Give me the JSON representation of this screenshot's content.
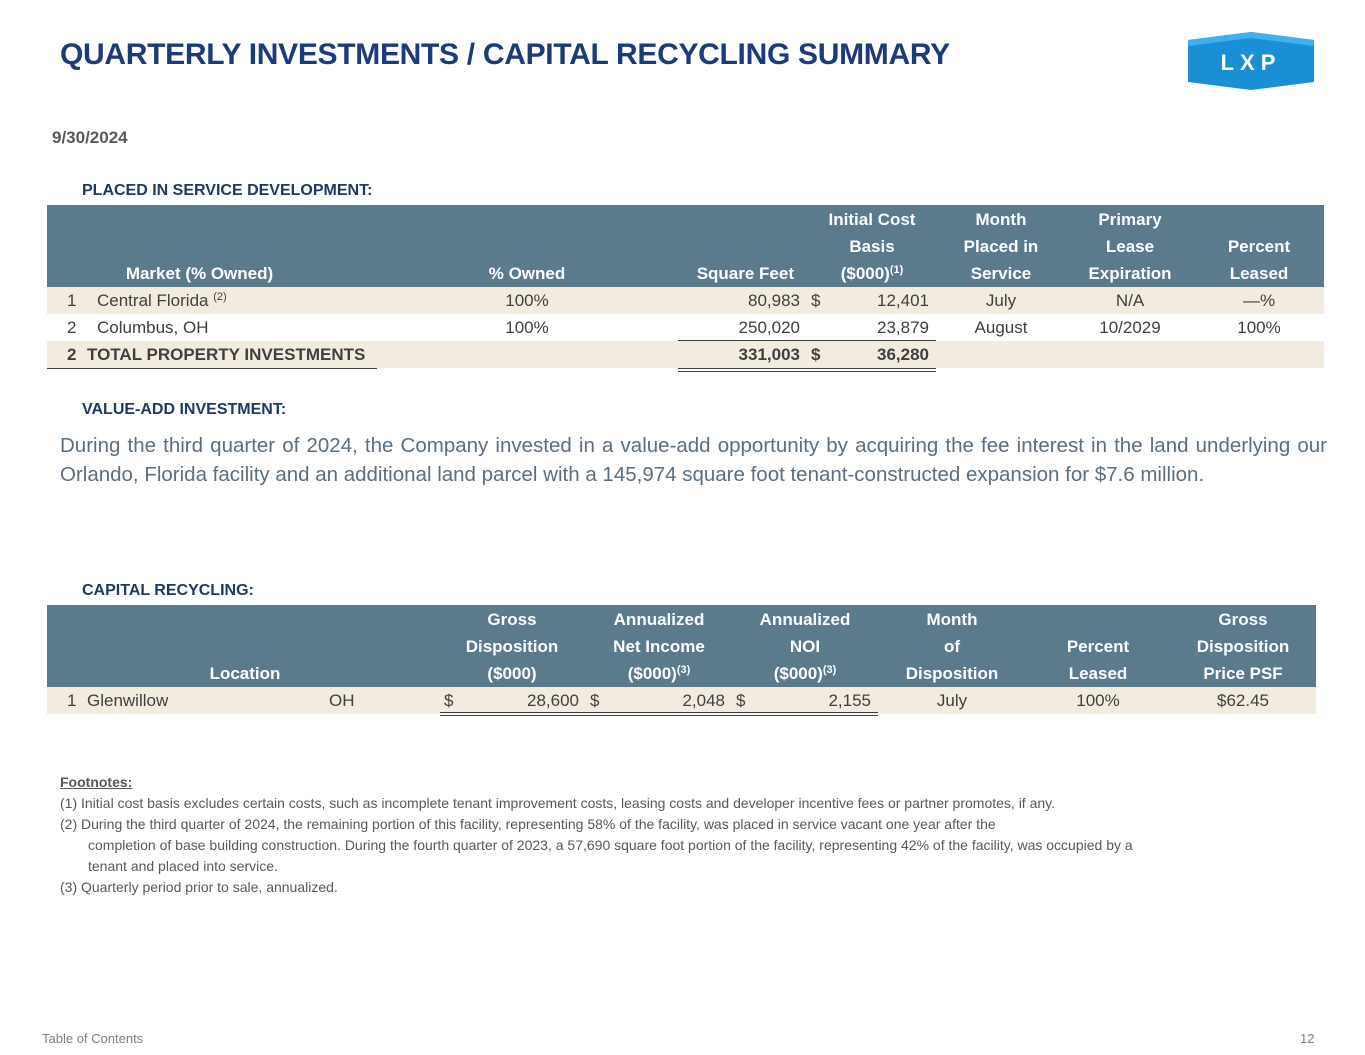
{
  "header": {
    "title": "QUARTERLY INVESTMENTS / CAPITAL RECYCLING SUMMARY",
    "logo_text": "LXP",
    "date": "9/30/2024"
  },
  "placed": {
    "label": "PLACED IN SERVICE DEVELOPMENT:",
    "headers": {
      "market": "Market (% Owned)",
      "owned": "% Owned",
      "sqft": "Square Feet",
      "cost_1": "Initial Cost",
      "cost_2": "Basis",
      "cost_3": "($000)",
      "cost_sup": "(1)",
      "month_1": "Month",
      "month_2": "Placed in",
      "month_3": "Service",
      "lease_1": "Primary",
      "lease_2": "Lease",
      "lease_3": "Expiration",
      "pct_1": "Percent",
      "pct_2": "Leased"
    },
    "rows": [
      {
        "num": "1",
        "market": "Central Florida",
        "sup": "(2)",
        "owned": "100%",
        "sqft": "80,983",
        "dollar": "$",
        "cost": "12,401",
        "month": "July",
        "lease": "N/A",
        "pct": "—%"
      },
      {
        "num": "2",
        "market": "Columbus, OH",
        "sup": "",
        "owned": "100%",
        "sqft": "250,020",
        "dollar": "",
        "cost": "23,879",
        "month": "August",
        "lease": "10/2029",
        "pct": "100%"
      }
    ],
    "total": {
      "num": "2",
      "label": "TOTAL PROPERTY INVESTMENTS",
      "sqft": "331,003",
      "dollar": "$",
      "cost": "36,280"
    }
  },
  "value_add": {
    "label": "VALUE-ADD INVESTMENT:",
    "text": "During the third quarter of 2024, the Company invested in a value-add opportunity by acquiring the fee interest in the land underlying our Orlando, Florida facility and an additional land parcel with a 145,974 square foot tenant-constructed expansion for $7.6 million."
  },
  "recycling": {
    "label": "CAPITAL RECYCLING:",
    "headers": {
      "location": "Location",
      "gross_1": "Gross",
      "gross_2": "Disposition",
      "gross_3": "($000)",
      "ni_1": "Annualized",
      "ni_2": "Net Income",
      "ni_3": "($000)",
      "ni_sup": "(3)",
      "noi_1": "Annualized",
      "noi_2": "NOI",
      "noi_3": "($000)",
      "noi_sup": "(3)",
      "month_1": "Month",
      "month_2": "of",
      "month_3": "Disposition",
      "pct_1": "Percent",
      "pct_2": "Leased",
      "psf_1": "Gross",
      "psf_2": "Disposition",
      "psf_3": "Price PSF"
    },
    "row": {
      "num": "1",
      "location": "Glenwillow",
      "state": "OH",
      "d1": "$",
      "gross": "28,600",
      "d2": "$",
      "ni": "2,048",
      "d3": "$",
      "noi": "2,155",
      "month": "July",
      "pct": "100%",
      "psf": "$62.45"
    }
  },
  "footnotes": {
    "title": "Footnotes:",
    "f1": "(1)  Initial cost basis excludes certain costs, such as incomplete tenant improvement costs, leasing costs and developer incentive fees or partner promotes, if any.",
    "f2a": "(2)  During the third quarter of 2024, the remaining portion of this facility, representing 58% of the facility, was placed in service vacant one year after the",
    "f2b": "completion of base building construction. During the fourth quarter of 2023, a 57,690 square foot portion of the facility, representing 42% of the facility, was occupied by a",
    "f2c": "tenant and placed into service.",
    "f3": "(3)  Quarterly period prior to sale, annualized."
  },
  "footer": {
    "toc": "Table of Contents",
    "page": "12"
  }
}
